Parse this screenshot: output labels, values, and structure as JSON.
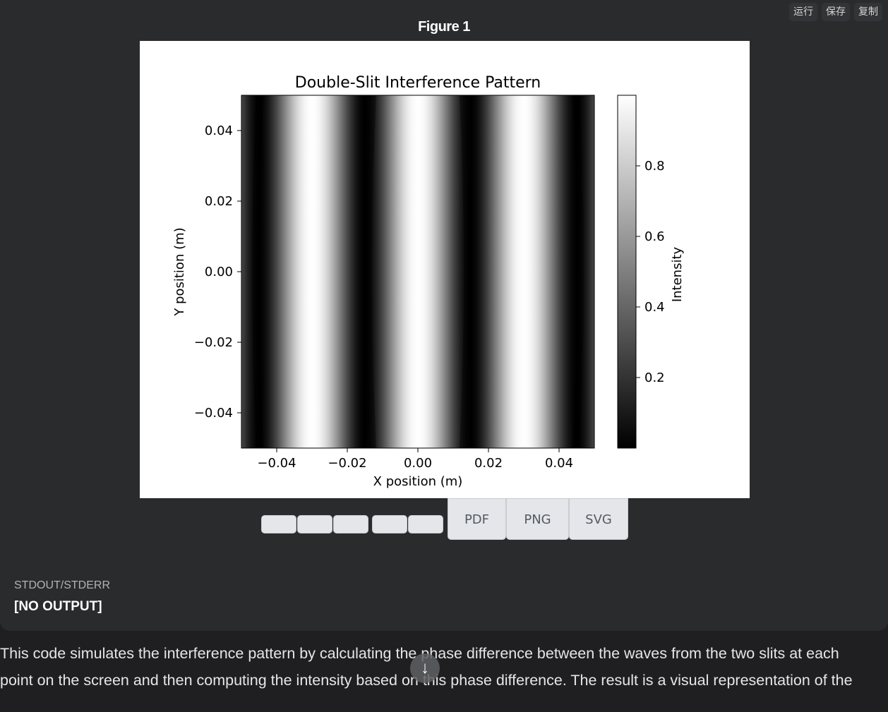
{
  "toolbar": {
    "run": "运行",
    "save": "保存",
    "copy": "复制"
  },
  "figure": {
    "title": "Figure 1"
  },
  "chart_data": {
    "type": "heatmap",
    "title": "Double-Slit Interference Pattern",
    "xlabel": "X position (m)",
    "ylabel": "Y position (m)",
    "xlim": [
      -0.05,
      0.05
    ],
    "ylim": [
      -0.05,
      0.05
    ],
    "xticks": [
      -0.04,
      -0.02,
      0.0,
      0.02,
      0.04
    ],
    "xtick_labels": [
      "−0.04",
      "−0.02",
      "0.00",
      "0.02",
      "0.04"
    ],
    "yticks": [
      0.04,
      0.02,
      0.0,
      -0.02,
      -0.04
    ],
    "ytick_labels": [
      "0.04",
      "0.02",
      "0.00",
      "−0.02",
      "−0.04"
    ],
    "colormap": "gray",
    "colorbar": {
      "label": "Intensity",
      "range": [
        0,
        1
      ],
      "ticks": [
        0.8,
        0.6,
        0.4,
        0.2
      ],
      "tick_labels": [
        "0.8",
        "0.6",
        "0.4",
        "0.2"
      ]
    },
    "fringe_minima_x": [
      -0.046,
      -0.014,
      0.014,
      0.046
    ],
    "fringe_maxima_x": [
      -0.03,
      0.0,
      0.03
    ],
    "grid": false
  },
  "download": {
    "pdf": "PDF",
    "png": "PNG",
    "svg": "SVG"
  },
  "output": {
    "label": "STDOUT/STDERR",
    "value": "[NO OUTPUT]"
  },
  "explanation": {
    "line1": "This code simulates the interference pattern by calculating the phase difference between the waves from the two slits at each",
    "line2": "point on the screen and then computing the intensity based on this phase difference. The result is a visual representation of the"
  },
  "scroll_icon": "arrow-down-icon"
}
